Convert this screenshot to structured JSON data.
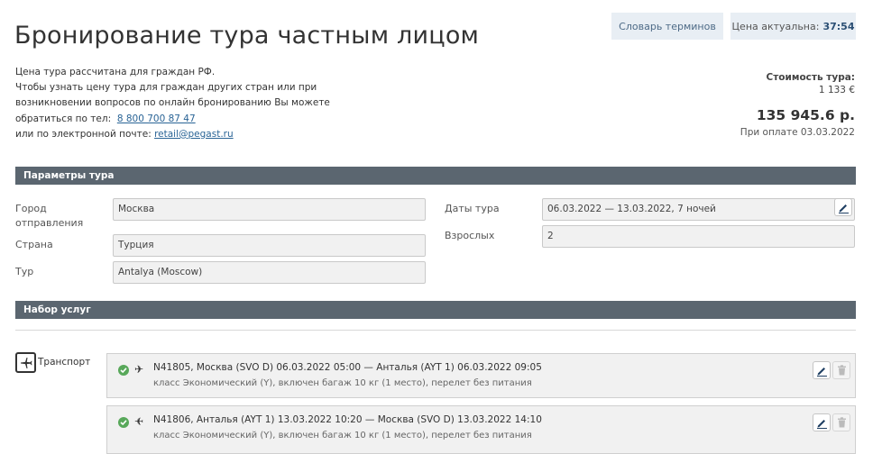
{
  "header": {
    "title": "Бронирование тура частным лицом",
    "glossary_button": "Словарь терминов",
    "price_actual_label": "Цена актуальна:",
    "price_actual_timer": "37:54"
  },
  "info": {
    "line1": "Цена тура рассчитана для граждан РФ.",
    "line2": "Чтобы узнать цену тура для граждан других стран или при",
    "line3": "возникновении вопросов по онлайн бронированию Вы можете",
    "line4_prefix": "обратиться по тел:",
    "phone": "8 800 700 87 47",
    "line5_prefix": "или по электронной почте:",
    "email": "retail@pegast.ru"
  },
  "cost": {
    "label": "Стоимость тура:",
    "eur": "1 133 €",
    "rub": "135 945.6 р.",
    "payment_note": "При оплате 03.03.2022"
  },
  "params": {
    "section_title": "Параметры тура",
    "city_label": "Город отправления",
    "city_value": "Москва",
    "country_label": "Страна",
    "country_value": "Турция",
    "tour_label": "Тур",
    "tour_value": "Antalya (Moscow)",
    "dates_label": "Даты тура",
    "dates_value": "06.03.2022 — 13.03.2022, 7  ночей",
    "adults_label": "Взрослых",
    "adults_value": "2"
  },
  "services": {
    "section_title": "Набор услуг",
    "transport_label": "Транспорт",
    "flights": [
      {
        "route": "N41805, Москва (SVO D) 06.03.2022 05:00 — Анталья (AYT 1) 06.03.2022 09:05",
        "desc": "класс Экономический (Y), включен багаж 10 кг (1 место), перелет без питания"
      },
      {
        "route": "N41806, Анталья (AYT 1) 13.03.2022 10:20 — Москва (SVO D) 13.03.2022 14:10",
        "desc": "класс Экономический (Y), включен багаж 10 кг (1 место), перелет без питания"
      }
    ]
  },
  "colors": {
    "section_bar": "#5b6670",
    "link": "#2a6496",
    "check": "#58a85a",
    "top_button_bg": "#e8eef4"
  },
  "icons": {
    "edit": "pencil-icon",
    "delete": "trash-icon",
    "transport": "airplane-icon",
    "confirmed": "check-circle-icon"
  }
}
